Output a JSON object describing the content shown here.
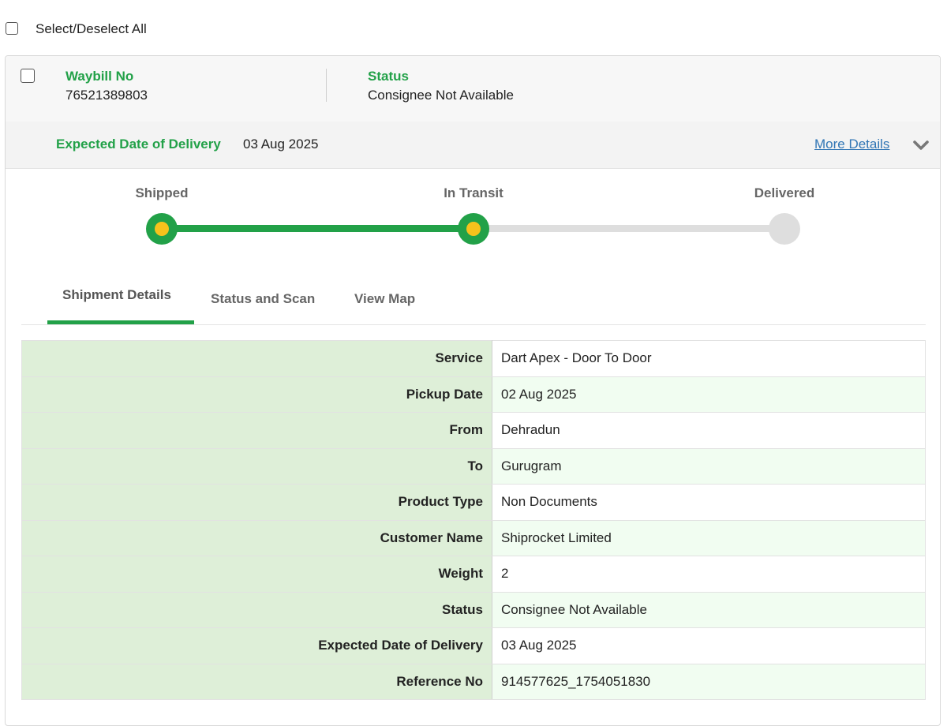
{
  "select_all": {
    "label": "Select/Deselect All",
    "checked": false
  },
  "shipment": {
    "checked": false,
    "waybill_label": "Waybill No",
    "waybill_no": "76521389803",
    "status_label": "Status",
    "status_value": "Consignee Not Available",
    "edd_label": "Expected Date of Delivery",
    "edd_value": "03 Aug 2025",
    "more_details_label": "More Details",
    "expand_icon": "chevron-down-icon"
  },
  "progress": {
    "steps": [
      {
        "label": "Shipped",
        "state": "done"
      },
      {
        "label": "In Transit",
        "state": "done"
      },
      {
        "label": "Delivered",
        "state": "pending"
      }
    ],
    "colors": {
      "done": "#22a148",
      "current_dot": "#f6c21c",
      "pending": "#dedede"
    }
  },
  "tabs": [
    {
      "label": "Shipment Details",
      "active": true
    },
    {
      "label": "Status and Scan",
      "active": false
    },
    {
      "label": "View Map",
      "active": false
    }
  ],
  "details": [
    {
      "key": "Service",
      "value": "Dart Apex - Door To Door"
    },
    {
      "key": "Pickup Date",
      "value": "02 Aug 2025"
    },
    {
      "key": "From",
      "value": "Dehradun"
    },
    {
      "key": "To",
      "value": "Gurugram"
    },
    {
      "key": "Product Type",
      "value": "Non Documents"
    },
    {
      "key": "Customer Name",
      "value": "Shiprocket Limited"
    },
    {
      "key": "Weight",
      "value": "2"
    },
    {
      "key": "Status",
      "value": "Consignee Not Available"
    },
    {
      "key": "Expected Date of Delivery",
      "value": "03 Aug 2025"
    },
    {
      "key": "Reference No",
      "value": "914577625_1754051830"
    }
  ],
  "theme": {
    "accent": "#22a148",
    "link": "#3176b5",
    "label_bg": "#deefd8",
    "alt_row_bg": "#f1fdf1"
  }
}
